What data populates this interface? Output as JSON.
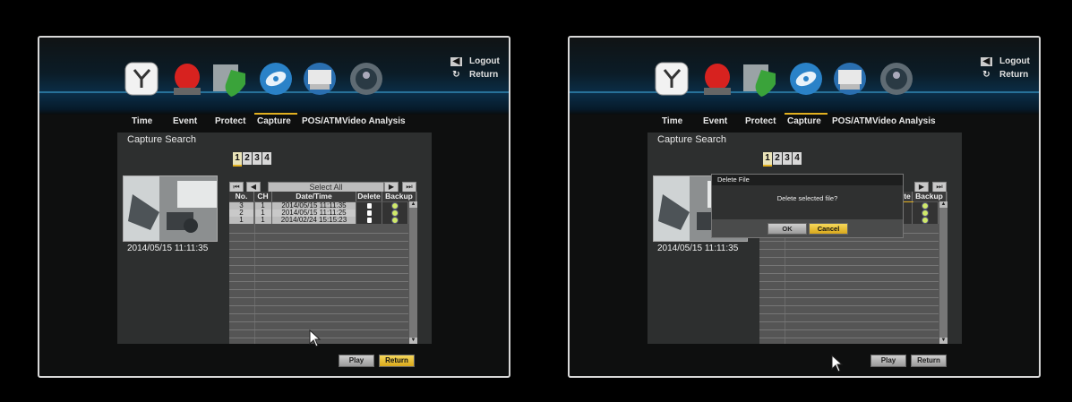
{
  "menu": {
    "items": [
      {
        "label": "Time",
        "icon": "clock-icon"
      },
      {
        "label": "Event",
        "icon": "siren-icon"
      },
      {
        "label": "Protect",
        "icon": "shield-icon"
      },
      {
        "label": "Capture",
        "icon": "disc-icon"
      },
      {
        "label": "POS/ATM",
        "icon": "atm-icon"
      },
      {
        "label": "Video Analysis",
        "icon": "analysis-icon"
      }
    ],
    "active": "Capture"
  },
  "top_right": {
    "logout": "Logout",
    "return": "Return"
  },
  "screen": {
    "title": "Capture Search",
    "channel_tabs": [
      "1",
      "2",
      "3",
      "4"
    ],
    "thumbnail_timestamp": "2014/05/15 11:11:35",
    "select_all": "Select All",
    "table": {
      "columns": [
        "No.",
        "CH",
        "Date/Time",
        "Delete",
        "Backup"
      ],
      "rows": [
        {
          "no": "3",
          "ch": "1",
          "datetime": "2014/05/15 11:11:35"
        },
        {
          "no": "2",
          "ch": "1",
          "datetime": "2014/05/15 11:11:25"
        },
        {
          "no": "1",
          "ch": "1",
          "datetime": "2014/02/24 15:15:23"
        }
      ]
    },
    "buttons": {
      "play": "Play",
      "return": "Return"
    }
  },
  "dialog": {
    "title": "Delete File",
    "message": "Delete selected file?",
    "ok": "OK",
    "cancel": "Cancel"
  },
  "colors": {
    "accent": "#e2b020",
    "header_blue": "#0b2e48"
  }
}
